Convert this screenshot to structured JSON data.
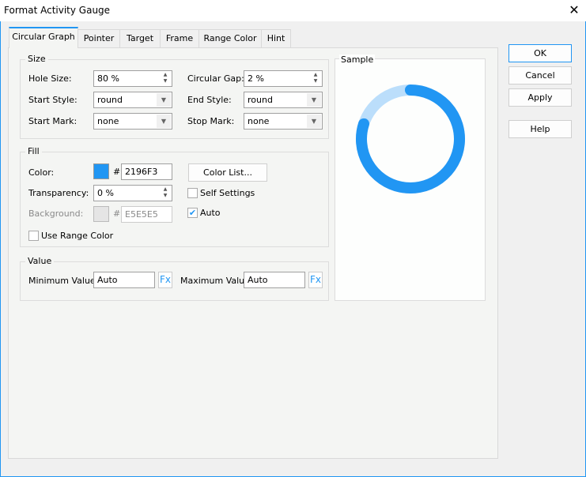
{
  "title": "Format Activity Gauge",
  "tabs": [
    "Circular Graph",
    "Pointer",
    "Target",
    "Frame",
    "Range Color",
    "Hint"
  ],
  "size": {
    "legend": "Size",
    "hole_label": "Hole Size:",
    "hole_value": "80 %",
    "gap_label": "Circular Gap:",
    "gap_value": "2 %",
    "start_style_label": "Start Style:",
    "start_style": "round",
    "end_style_label": "End Style:",
    "end_style": "round",
    "start_mark_label": "Start Mark:",
    "start_mark": "none",
    "stop_mark_label": "Stop Mark:",
    "stop_mark": "none"
  },
  "fill": {
    "legend": "Fill",
    "color_label": "Color:",
    "hash": "#",
    "color_value": "2196F3",
    "color_list": "Color List...",
    "transparency_label": "Transparency:",
    "transparency_value": "0 %",
    "self_settings": "Self Settings",
    "self_settings_checked": false,
    "background_label": "Background:",
    "background_value": "E5E5E5",
    "auto": "Auto",
    "auto_checked": true,
    "use_range_color": "Use Range Color",
    "use_range_checked": false
  },
  "value": {
    "legend": "Value",
    "min_label": "Minimum Value:",
    "min_value": "Auto",
    "max_label": "Maximum Value:",
    "max_value": "Auto",
    "fx": "Fx"
  },
  "sample": {
    "legend": "Sample",
    "progress": 0.8
  },
  "buttons": {
    "ok": "OK",
    "cancel": "Cancel",
    "apply": "Apply",
    "help": "Help"
  },
  "colors": {
    "accent": "#2196F3",
    "track": "#BBDEFB",
    "background": "#E5E5E5"
  }
}
